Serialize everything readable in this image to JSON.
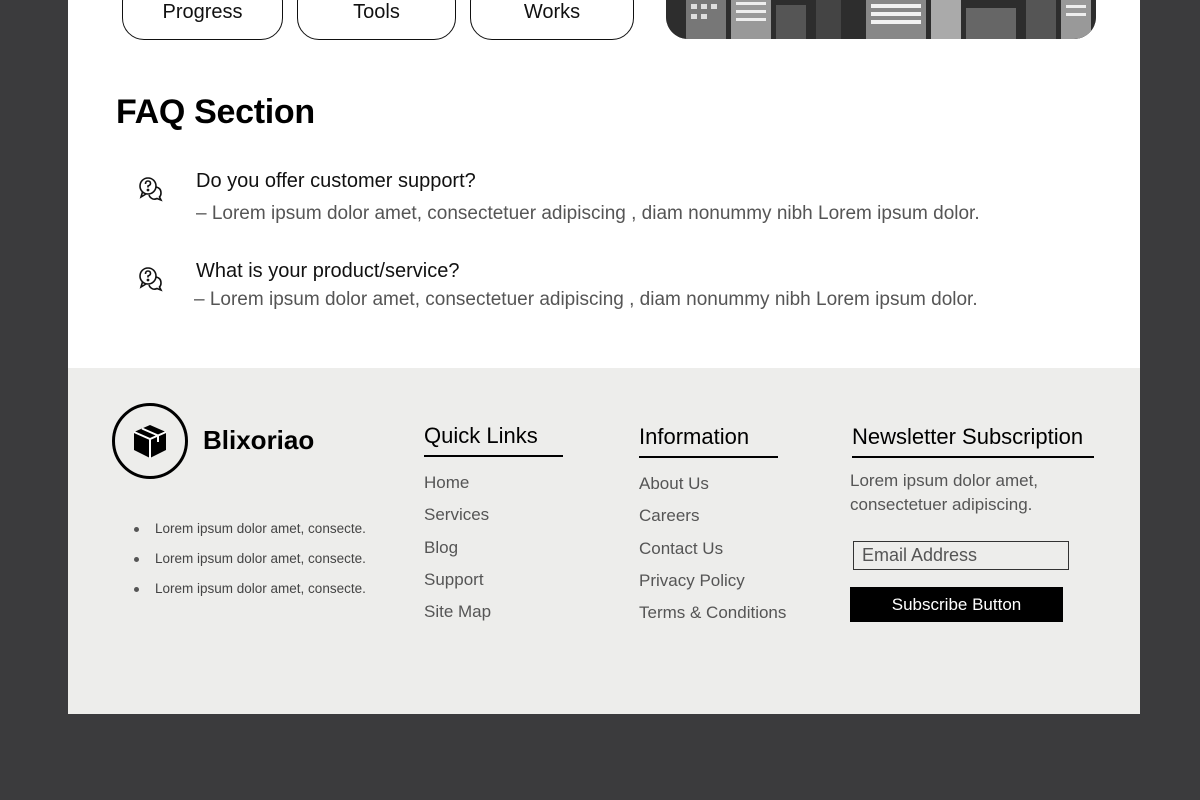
{
  "top_pills": {
    "progress": "Progress",
    "tools": "Tools",
    "works": "Works"
  },
  "faq": {
    "title": "FAQ Section",
    "items": [
      {
        "question": "Do you offer customer support?",
        "answer": "–  Lorem ipsum dolor amet, consectetuer adipiscing , diam nonummy nibh Lorem ipsum dolor.",
        "icon": "question-chat-icon"
      },
      {
        "question": "What is your product/service?",
        "answer": "–  Lorem ipsum dolor amet, consectetuer adipiscing , diam nonummy nibh Lorem ipsum dolor.",
        "icon": "question-chat-icon"
      }
    ]
  },
  "footer": {
    "brand": {
      "name": "Blixoriao",
      "icon": "box-icon"
    },
    "bullets": [
      "Lorem ipsum dolor amet, consecte.",
      "Lorem ipsum dolor amet, consecte.",
      "Lorem ipsum dolor amet, consecte."
    ],
    "quick_links": {
      "title": "Quick Links",
      "items": [
        "Home",
        "Services",
        "Blog",
        "Support",
        "Site Map"
      ]
    },
    "information": {
      "title": "Information",
      "items": [
        "About Us",
        "Careers",
        "Contact Us",
        "Privacy Policy",
        "Terms & Conditions"
      ]
    },
    "newsletter": {
      "title": "Newsletter Subscription",
      "text": "Lorem ipsum dolor amet, consectetuer adipiscing.",
      "email_placeholder": "Email Address",
      "button": "Subscribe Button"
    }
  },
  "colors": {
    "background": "#3b3b3d",
    "page": "#ffffff",
    "footer": "#ededeb",
    "accent": "#000000"
  }
}
